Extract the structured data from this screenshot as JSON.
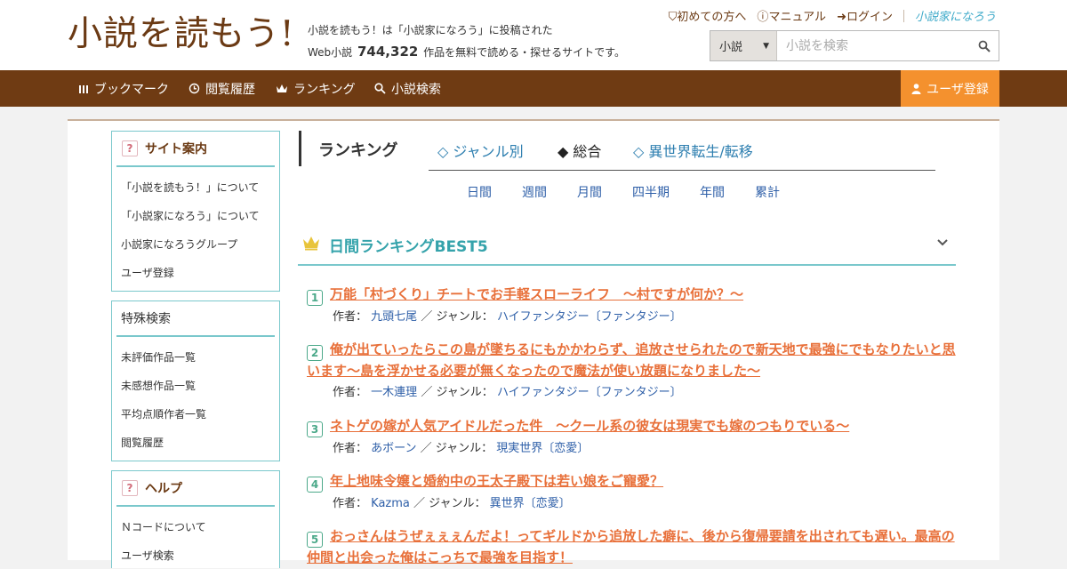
{
  "header": {
    "logo": "小説を読もう!",
    "desc_line1": "小説を読もう！は「小説家になろう」に投稿された",
    "desc_prefix": "Web小説",
    "novel_count": "744,322",
    "desc_suffix": "作品を無料で読める・探せるサイトです。",
    "links": [
      "初めての方へ",
      "マニュアル",
      "ログイン"
    ],
    "narou_logo": "小説家になろう"
  },
  "search": {
    "type": "小説",
    "placeholder": "小説を検索"
  },
  "nav": {
    "items": [
      "ブックマーク",
      "閲覧履歴",
      "ランキング",
      "小説検索"
    ],
    "register": "ユーザ登録"
  },
  "sidebar": {
    "site_guide": {
      "title": "サイト案内",
      "items": [
        "「小説を読もう！」について",
        "「小説家になろう」について",
        "小説家になろうグループ",
        "ユーザ登録"
      ]
    },
    "special_search": {
      "title": "特殊検索",
      "items": [
        "未評価作品一覧",
        "未感想作品一覧",
        "平均点順作者一覧",
        "閲覧履歴"
      ]
    },
    "help": {
      "title": "ヘルプ",
      "items": [
        "Ｎコードについて",
        "ユーザ検索"
      ]
    }
  },
  "ranking": {
    "title": "ランキング",
    "tabs": [
      "◇ ジャンル別",
      "◆ 総合",
      "◇ 異世界転生/転移"
    ],
    "periods": [
      "日間",
      "週間",
      "月間",
      "四半期",
      "年間",
      "累計"
    ],
    "best_title": "日間ランキングBEST5",
    "author_label": "作者：",
    "genre_label": "／ ジャンル：",
    "entries": [
      {
        "rank": "1",
        "title": "万能「村づくり」チートでお手軽スローライフ　～村ですが何か？～",
        "author": "九頭七尾",
        "genre": "ハイファンタジー〔ファンタジー〕"
      },
      {
        "rank": "2",
        "title": "俺が出ていったらこの島が墜ちるにもかかわらず、追放させられたので新天地で最強にでもなりたいと思います～島を浮かせる必要が無くなったので魔法が使い放題になりました～",
        "author": "一木連理",
        "genre": "ハイファンタジー〔ファンタジー〕"
      },
      {
        "rank": "3",
        "title": "ネトゲの嫁が人気アイドルだった件　～クール系の彼女は現実でも嫁のつもりでいる～",
        "author": "あボーン",
        "genre": "現実世界〔恋愛〕"
      },
      {
        "rank": "4",
        "title": "年上地味令嬢と婚約中の王太子殿下は若い娘をご寵愛？",
        "author": "Kazma",
        "genre": "異世界〔恋愛〕"
      },
      {
        "rank": "5",
        "title": "おっさんはうぜぇぇぇんだよ！ってギルドから追放した癖に、後から復帰要請を出されても遅い。最高の仲間と出会った俺はこっちで最強を目指す！",
        "author": "",
        "genre": ""
      }
    ]
  },
  "colors": {
    "brown": "#6f3b13",
    "orange": "#f4912e",
    "teal": "#7ac8cc",
    "title": "#e8703a",
    "link": "#2e5fa8"
  }
}
